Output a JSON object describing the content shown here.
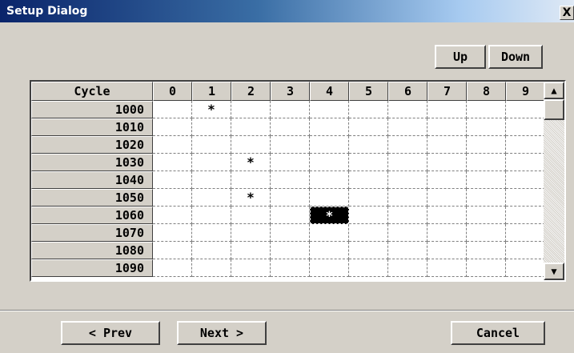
{
  "window": {
    "title": "Setup Dialog",
    "close_label": "X"
  },
  "toolbar": {
    "up_label": "Up",
    "down_label": "Down"
  },
  "grid": {
    "corner_header": "Cycle",
    "columns": [
      "0",
      "1",
      "2",
      "3",
      "4",
      "5",
      "6",
      "7",
      "8",
      "9"
    ],
    "rows": [
      {
        "label": "1000",
        "cells": [
          "",
          "*",
          "",
          "",
          "",
          "",
          "",
          "",
          "",
          ""
        ]
      },
      {
        "label": "1010",
        "cells": [
          "",
          "",
          "",
          "",
          "",
          "",
          "",
          "",
          "",
          ""
        ]
      },
      {
        "label": "1020",
        "cells": [
          "",
          "",
          "",
          "",
          "",
          "",
          "",
          "",
          "",
          ""
        ]
      },
      {
        "label": "1030",
        "cells": [
          "",
          "",
          "*",
          "",
          "",
          "",
          "",
          "",
          "",
          ""
        ]
      },
      {
        "label": "1040",
        "cells": [
          "",
          "",
          "",
          "",
          "",
          "",
          "",
          "",
          "",
          ""
        ]
      },
      {
        "label": "1050",
        "cells": [
          "",
          "",
          "*",
          "",
          "",
          "",
          "",
          "",
          "",
          ""
        ]
      },
      {
        "label": "1060",
        "cells": [
          "",
          "",
          "",
          "",
          "*",
          "",
          "",
          "",
          "",
          ""
        ]
      },
      {
        "label": "1070",
        "cells": [
          "",
          "",
          "",
          "",
          "",
          "",
          "",
          "",
          "",
          ""
        ]
      },
      {
        "label": "1080",
        "cells": [
          "",
          "",
          "",
          "",
          "",
          "",
          "",
          "",
          "",
          ""
        ]
      },
      {
        "label": "1090",
        "cells": [
          "",
          "",
          "",
          "",
          "",
          "",
          "",
          "",
          "",
          ""
        ]
      }
    ],
    "selected": {
      "row": 6,
      "col": 4
    }
  },
  "scrollbar": {
    "up_icon": "▲",
    "down_icon": "▼"
  },
  "footer": {
    "prev_label": "< Prev",
    "next_label": "Next >",
    "cancel_label": "Cancel"
  }
}
